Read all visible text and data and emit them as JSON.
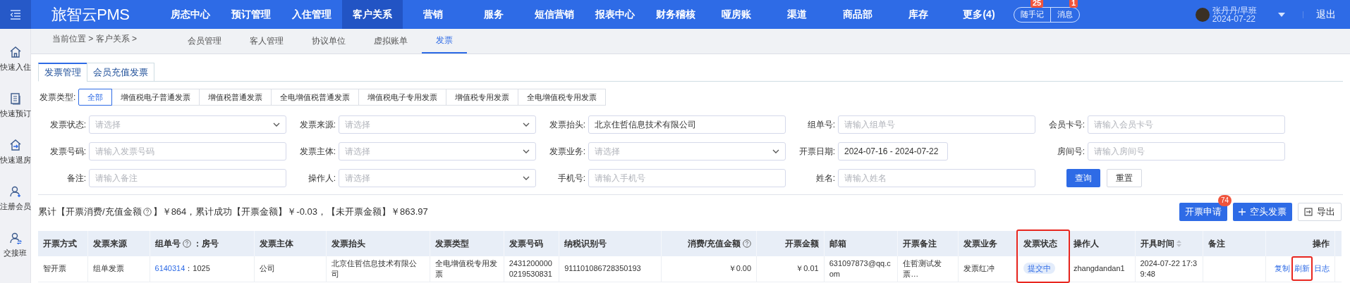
{
  "top_nav": {
    "logo": "旅智云PMS",
    "items": [
      {
        "label": "房态中心",
        "selected": false
      },
      {
        "label": "预订管理",
        "selected": false
      },
      {
        "label": "入住管理",
        "selected": false
      },
      {
        "label": "客户关系",
        "selected": true
      },
      {
        "label": "营销",
        "selected": false
      },
      {
        "label": "服务",
        "selected": false
      },
      {
        "label": "短信营销",
        "selected": false
      },
      {
        "label": "报表中心",
        "selected": false
      },
      {
        "label": "财务稽核",
        "selected": false
      },
      {
        "label": "哑房账",
        "selected": false
      },
      {
        "label": "渠道",
        "selected": false
      },
      {
        "label": "商品部",
        "selected": false
      },
      {
        "label": "库存",
        "selected": false
      },
      {
        "label": "更多(4)",
        "selected": false
      }
    ],
    "note_button": {
      "label": "随手记",
      "badge": "25"
    },
    "message_button": {
      "label": "消息",
      "badge": "1"
    },
    "user": {
      "name": "张丹丹/早班",
      "date": "2024-07-22"
    },
    "logout": "退出"
  },
  "sidebar": {
    "items": [
      {
        "label": "快速入住",
        "kind": "home"
      },
      {
        "label": "快速预订",
        "kind": "booking"
      },
      {
        "label": "快速退房",
        "kind": "checkout"
      },
      {
        "label": "注册会员",
        "kind": "member"
      },
      {
        "label": "交接班",
        "kind": "handover"
      }
    ]
  },
  "breadcrumb": "当前位置 > 客户关系 >",
  "sub_nav": [
    {
      "label": "会员管理",
      "selected": false
    },
    {
      "label": "客人管理",
      "selected": false
    },
    {
      "label": "协议单位",
      "selected": false
    },
    {
      "label": "虚拟账单",
      "selected": false
    },
    {
      "label": "发票",
      "selected": true
    }
  ],
  "tabs": [
    {
      "label": "发票管理",
      "selected": true
    },
    {
      "label": "会员充值发票",
      "selected": false
    }
  ],
  "invoice_type": {
    "label": "发票类型:",
    "options": [
      {
        "label": "全部",
        "selected": true
      },
      {
        "label": "增值税电子普通发票",
        "selected": false
      },
      {
        "label": "增值税普通发票",
        "selected": false
      },
      {
        "label": "全电增值税普通发票",
        "selected": false
      },
      {
        "label": "增值税电子专用发票",
        "selected": false
      },
      {
        "label": "增值税专用发票",
        "selected": false
      },
      {
        "label": "全电增值税专用发票",
        "selected": false
      }
    ]
  },
  "filters": [
    {
      "label": "发票状态:",
      "kind": "select",
      "placeholder": "请选择"
    },
    {
      "label": "发票来源:",
      "kind": "select",
      "placeholder": "请选择"
    },
    {
      "label": "发票抬头:",
      "kind": "input",
      "value": "北京住哲信息技术有限公司"
    },
    {
      "label": "组单号:",
      "kind": "input",
      "placeholder": "请输入组单号"
    },
    {
      "label": "会员卡号:",
      "kind": "input",
      "placeholder": "请输入会员卡号"
    },
    {
      "label": "发票号码:",
      "kind": "input",
      "placeholder": "请输入发票号码"
    },
    {
      "label": "发票主体:",
      "kind": "select",
      "placeholder": "请选择"
    },
    {
      "label": "发票业务:",
      "kind": "select",
      "placeholder": "请选择"
    },
    {
      "label": "开票日期:",
      "kind": "date",
      "value": "2024-07-16 - 2024-07-22"
    },
    {
      "label": "房间号:",
      "kind": "input",
      "placeholder": "请输入房间号"
    },
    {
      "label": "备注:",
      "kind": "input",
      "placeholder": "请输入备注"
    },
    {
      "label": "操作人:",
      "kind": "select",
      "placeholder": "请选择"
    },
    {
      "label": "手机号:",
      "kind": "input",
      "placeholder": "请输入手机号"
    },
    {
      "label": "姓名:",
      "kind": "input",
      "placeholder": "请输入姓名"
    }
  ],
  "search_button": "查询",
  "reset_button": "重置",
  "summary": {
    "before_help": "累计【开票消费/充值金额",
    "after_help": "】￥864，累计成功【开票金额】￥-0.03，【未开票金额】￥863.97"
  },
  "toolbar": {
    "apply_button": {
      "label": "开票申请",
      "badge": "74"
    },
    "blank_button": "空头发票",
    "export_button": "导出"
  },
  "table": {
    "columns": [
      {
        "label": "开票方式",
        "kind": "text"
      },
      {
        "label": "发票来源",
        "kind": "text"
      },
      {
        "label": "组单号",
        "suffix": "：房号",
        "kind": "text",
        "help": true
      },
      {
        "label": "发票主体",
        "kind": "text"
      },
      {
        "label": "发票抬头",
        "kind": "text"
      },
      {
        "label": "发票类型",
        "kind": "text"
      },
      {
        "label": "发票号码",
        "kind": "text"
      },
      {
        "label": "纳税识别号",
        "kind": "text"
      },
      {
        "label": "消费/充值金额",
        "kind": "amount",
        "help": true
      },
      {
        "label": "开票金额",
        "kind": "amount"
      },
      {
        "label": "邮箱",
        "kind": "text"
      },
      {
        "label": "开票备注",
        "kind": "text"
      },
      {
        "label": "发票业务",
        "kind": "text"
      },
      {
        "label": "发票状态",
        "kind": "text",
        "highlighted": true
      },
      {
        "label": "操作人",
        "kind": "text"
      },
      {
        "label": "开具时间",
        "kind": "text",
        "sortable": true
      },
      {
        "label": "备注",
        "kind": "text"
      },
      {
        "label": "操作",
        "kind": "actions"
      }
    ],
    "rows": [
      {
        "cells": [
          {
            "kind": "text",
            "text": "智开票"
          },
          {
            "kind": "text",
            "text": "组单发票"
          },
          {
            "kind": "link",
            "link": "6140314",
            "text": "：1025"
          },
          {
            "kind": "text",
            "text": "公司"
          },
          {
            "kind": "text",
            "text": "北京住哲信息技术有限公司"
          },
          {
            "kind": "text",
            "text": "全电增值税专用发票"
          },
          {
            "kind": "text",
            "text": "24312000000219530831"
          },
          {
            "kind": "text",
            "text": "911101086728350193"
          },
          {
            "kind": "amount",
            "text": "￥0.00"
          },
          {
            "kind": "amount",
            "text": "￥0.01"
          },
          {
            "kind": "text",
            "text": "631097873@qq.com"
          },
          {
            "kind": "text",
            "text": "住哲测试发票…"
          },
          {
            "kind": "text",
            "text": "发票红冲"
          },
          {
            "kind": "badge",
            "text": "提交中"
          },
          {
            "kind": "text",
            "text": "zhangdandan1"
          },
          {
            "kind": "text",
            "text": "2024-07-22 17:39:48"
          },
          null,
          {
            "kind": "actions",
            "actions": [
              {
                "label": "复制"
              },
              {
                "label": "刷新",
                "highlighted": true
              },
              {
                "label": "日志"
              }
            ]
          }
        ]
      }
    ]
  }
}
